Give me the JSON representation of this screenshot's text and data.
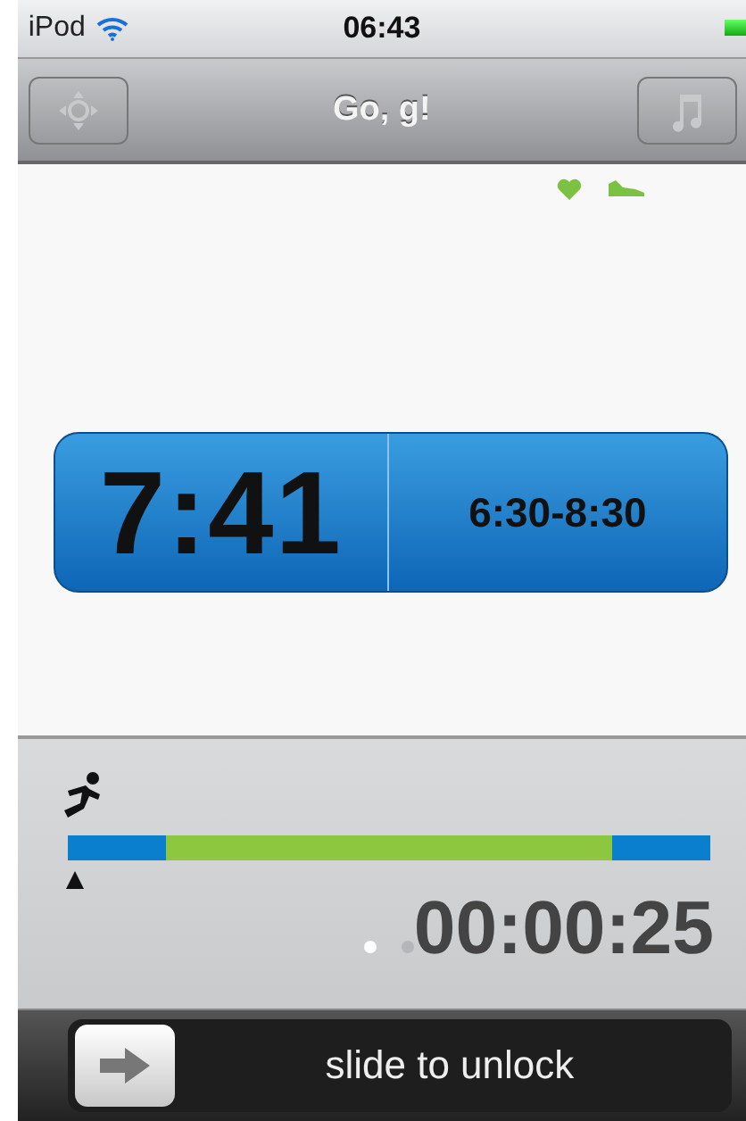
{
  "status_bar": {
    "carrier": "iPod",
    "time": "06:43"
  },
  "nav_bar": {
    "title": "Go, g!"
  },
  "pace": {
    "current": "7:41",
    "target_range": "6:30-8:30"
  },
  "elapsed": "00:00:25",
  "page_dots": [
    {
      "selected": true
    },
    {
      "selected": false
    }
  ],
  "unlock": {
    "label": "slide to unlock",
    "level": 0
  }
}
